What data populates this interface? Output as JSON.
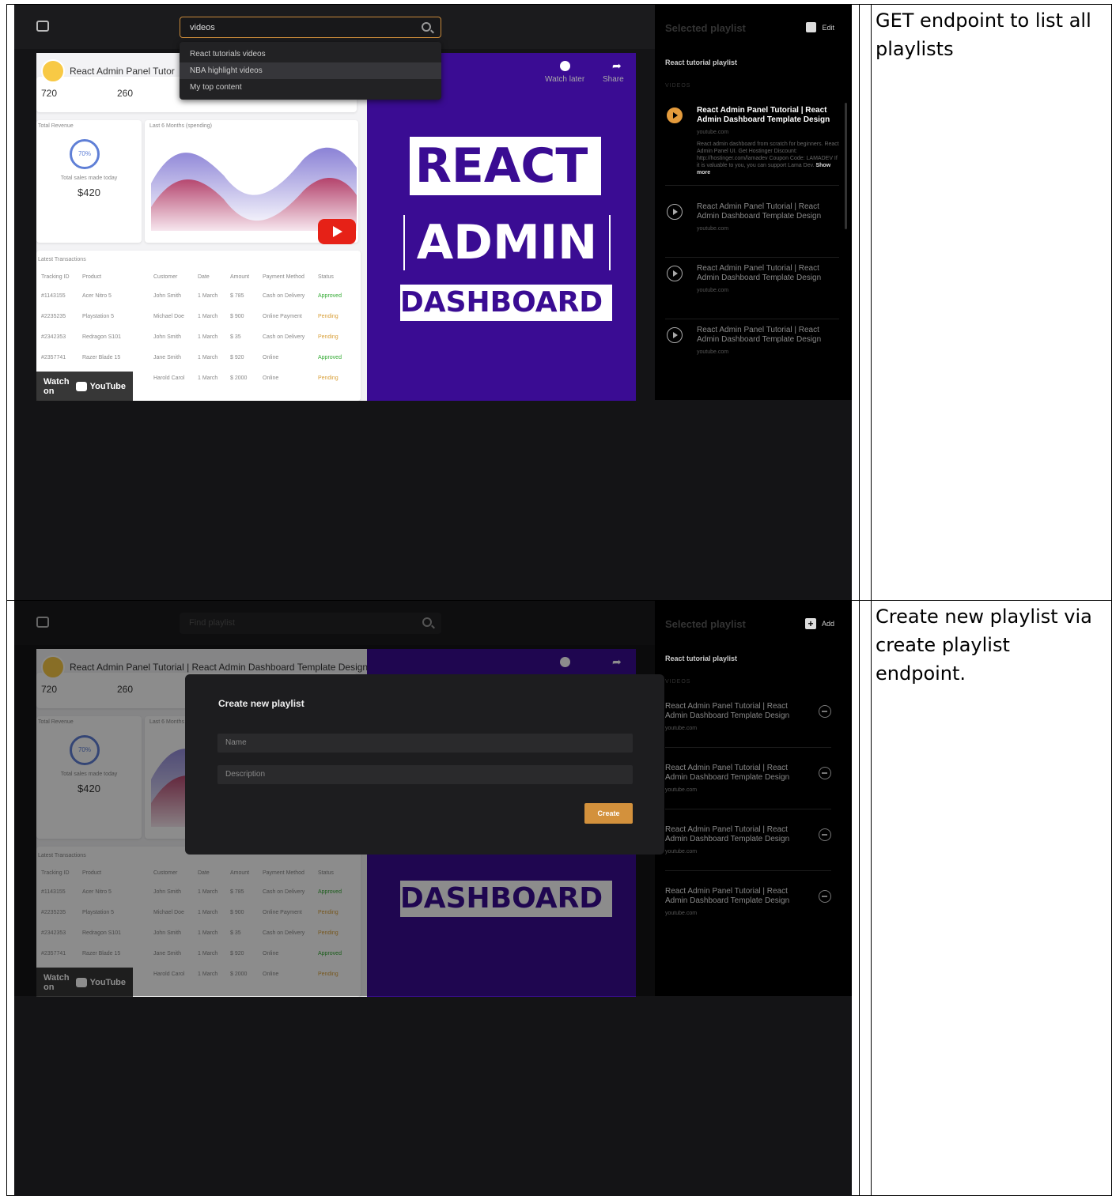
{
  "notes": {
    "row1": "GET endpoint to list all playlists",
    "row2": "Create new playlist via create playlist endpoint."
  },
  "screen1": {
    "search_value": "videos",
    "dropdown": [
      "React tutorials videos",
      "NBA highlight videos",
      "My top content"
    ],
    "panel_title": "Selected playlist",
    "panel_action": "Edit"
  },
  "screen2": {
    "search_placeholder": "Find playlist",
    "panel_title": "Selected playlist",
    "panel_action": "Add",
    "modal": {
      "title": "Create new playlist",
      "name_placeholder": "Name",
      "description_placeholder": "Description",
      "create_label": "Create"
    }
  },
  "playlist": {
    "name": "React tutorial playlist",
    "videos_label": "VIDEOS",
    "items": [
      {
        "title": "React Admin Panel Tutorial | React Admin Dashboard Template Design",
        "source": "youtube.com",
        "description": "React admin dashboard from scratch for beginners. React Admin Panel UI. Get Hostinger Discount: http://hostinger.com/lamadev Coupon Code: LAMADEV If it is valuable to you, you can support Lama Dev.",
        "show_more": "Show more"
      },
      {
        "title": "React Admin Panel Tutorial | React Admin Dashboard Template Design",
        "source": "youtube.com"
      },
      {
        "title": "React Admin Panel Tutorial | React Admin Dashboard Template Design",
        "source": "youtube.com"
      },
      {
        "title": "React Admin Panel Tutorial | React Admin Dashboard Template Design",
        "source": "youtube.com"
      }
    ]
  },
  "video": {
    "title1": "React Admin Panel Tutor",
    "title2": "React Admin Panel Tutorial | React Admin Dashboard Template Design",
    "watch_later": "Watch later",
    "share": "Share",
    "watch_on": "Watch on",
    "youtube": "YouTube",
    "thumb_line1": "REACT",
    "thumb_line2": "ADMIN",
    "thumb_line3": "DASHBOARD",
    "stat1": "720",
    "stat2": "260",
    "revenue_pct": "70%",
    "revenue_label": "Total sales made today",
    "revenue_amount": "$420",
    "chart_label": "Last 6 Months (spending)",
    "revenue_title": "Total Revenue",
    "transactions_title": "Latest Transactions",
    "columns": [
      "Tracking ID",
      "Product",
      "Customer",
      "Date",
      "Amount",
      "Payment Method",
      "Status"
    ],
    "rows": [
      [
        "#1143155",
        "Acer Nitro 5",
        "John Smith",
        "1 March",
        "$ 785",
        "Cash on Delivery",
        "Approved"
      ],
      [
        "#2235235",
        "Playstation 5",
        "Michael Doe",
        "1 March",
        "$ 900",
        "Online Payment",
        "Pending"
      ],
      [
        "#2342353",
        "Redragon S101",
        "John Smith",
        "1 March",
        "$ 35",
        "Cash on Delivery",
        "Pending"
      ],
      [
        "#2357741",
        "Razer Blade 15",
        "Jane Smith",
        "1 March",
        "$ 920",
        "Online",
        "Approved"
      ],
      [
        "",
        "",
        "Harold Carol",
        "1 March",
        "$ 2000",
        "Online",
        "Pending"
      ]
    ]
  }
}
